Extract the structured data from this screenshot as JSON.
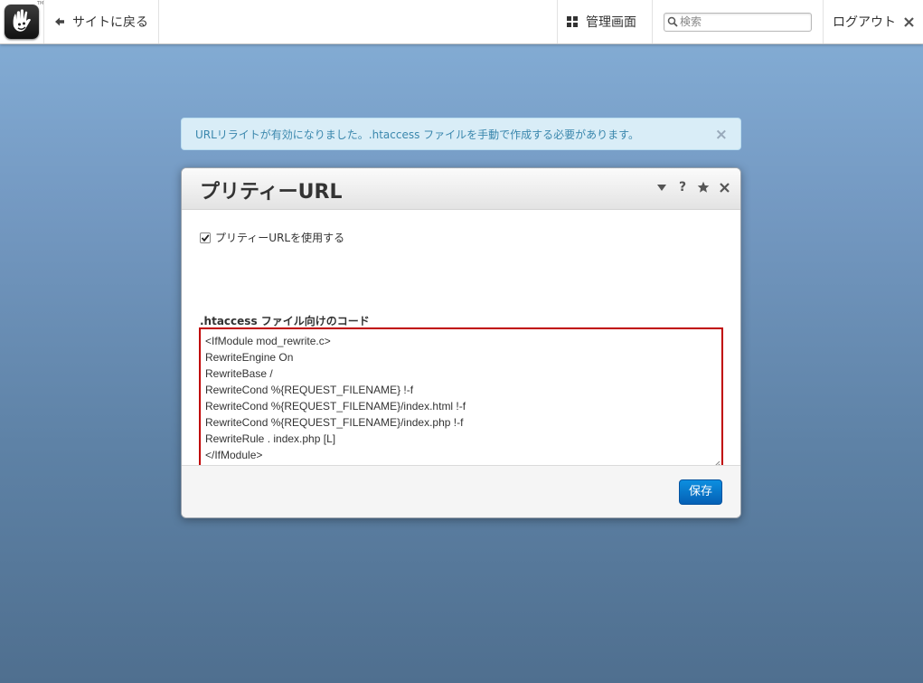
{
  "toolbar": {
    "back_label": "サイトに戻る",
    "dashboard_label": "管理画面",
    "search_placeholder": "検索",
    "logout_label": "ログアウト"
  },
  "alert": {
    "message": "URLリライトが有効になりました。.htaccess ファイルを手動で作成する必要があります。",
    "close": "×"
  },
  "panel": {
    "title": "プリティーURL",
    "help": "?",
    "checkbox_label": "プリティーURLを使用する",
    "checkbox_checked": true,
    "code_label": ".htaccess ファイル向けのコード",
    "code_lines": [
      "<IfModule mod_rewrite.c>",
      "RewriteEngine On",
      "RewriteBase /",
      "RewriteCond %{REQUEST_FILENAME} !-f",
      "RewriteCond %{REQUEST_FILENAME}/index.html !-f",
      "RewriteCond %{REQUEST_FILENAME}/index.php !-f",
      "RewriteRule . index.php [L]",
      "</IfModule>"
    ],
    "save_label": "保存"
  },
  "colors": {
    "accent": "#0560b5",
    "alert_bg": "#d9edf7",
    "alert_text": "#3a87ad",
    "highlight_border": "#c00000"
  },
  "icons": {
    "logo": "concrete5-hand-logo",
    "back": "arrow-left-icon",
    "dashboard": "grid-icon",
    "search": "search-icon",
    "logout_close": "close-icon",
    "panel_collapse": "triangle-down-icon",
    "panel_help": "help-icon",
    "panel_favorite": "star-icon",
    "panel_close": "close-icon"
  }
}
